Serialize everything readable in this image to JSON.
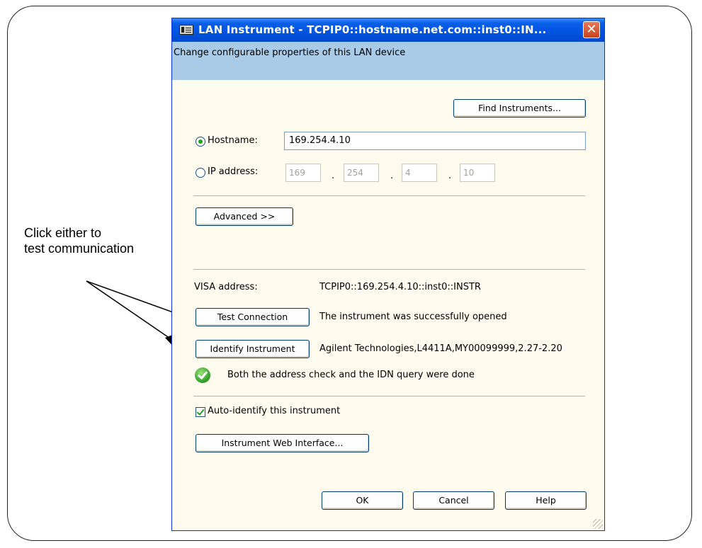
{
  "callout": {
    "line1": "Click either to",
    "line2": "test communication"
  },
  "dialog": {
    "title": "LAN Instrument - TCPIP0::hostname.net.com::inst0::IN...",
    "close_symbol": "✕",
    "description": "Change configurable properties of this LAN device",
    "find_instruments_label": "Find Instruments...",
    "hostname": {
      "label": "Hostname:",
      "value": "169.254.4.10",
      "selected": true
    },
    "ip_address": {
      "label": "IP address:",
      "octets": [
        "169",
        "254",
        "4",
        "10"
      ],
      "separator": ".",
      "selected": false
    },
    "advanced_label": "Advanced >>",
    "visa": {
      "label": "VISA address:",
      "value": "TCPIP0::169.254.4.10::inst0::INSTR"
    },
    "test_connection": {
      "label": "Test Connection",
      "result": "The instrument was successfully opened"
    },
    "identify_instrument": {
      "label": "Identify Instrument",
      "result": "Agilent Technologies,L4411A,MY00099999,2.27-2.20"
    },
    "status_message": "Both the address check and the IDN query were done",
    "auto_identify": {
      "label": "Auto-identify this instrument",
      "checked": true
    },
    "web_interface_label": "Instrument Web Interface...",
    "ok_label": "OK",
    "cancel_label": "Cancel",
    "help_label": "Help"
  },
  "icons": {
    "title_icon": "instrument-window-icon",
    "status_icon": "green-check-icon"
  },
  "colors": {
    "titlebar": "#0054e3",
    "description_band": "#a9cbe8",
    "dialog_body": "#fffbef",
    "close_button": "#d4562f"
  }
}
